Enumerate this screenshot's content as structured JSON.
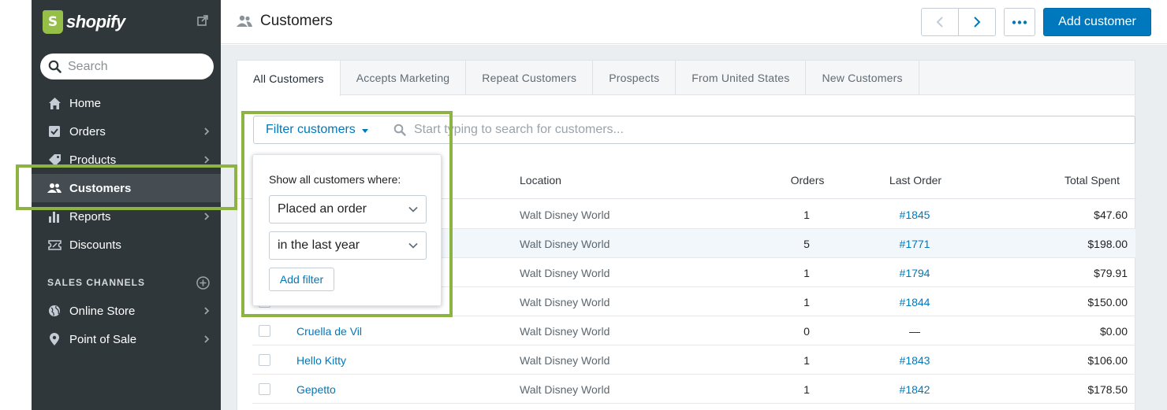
{
  "sidebar": {
    "logo": "shopify",
    "search_placeholder": "Search",
    "items": [
      {
        "label": "Home",
        "icon": "home-icon"
      },
      {
        "label": "Orders",
        "icon": "orders-icon"
      },
      {
        "label": "Products",
        "icon": "tag-icon"
      },
      {
        "label": "Customers",
        "icon": "customers-icon"
      },
      {
        "label": "Reports",
        "icon": "reports-icon"
      },
      {
        "label": "Discounts",
        "icon": "discount-icon"
      }
    ],
    "section_label": "SALES CHANNELS",
    "channels": [
      {
        "label": "Online Store",
        "icon": "globe-icon"
      },
      {
        "label": "Point of Sale",
        "icon": "location-pin-icon"
      }
    ]
  },
  "header": {
    "title": "Customers",
    "add_label": "Add customer"
  },
  "tabs": [
    {
      "label": "All Customers"
    },
    {
      "label": "Accepts Marketing"
    },
    {
      "label": "Repeat Customers"
    },
    {
      "label": "Prospects"
    },
    {
      "label": "From United States"
    },
    {
      "label": "New Customers"
    }
  ],
  "filter": {
    "button_label": "Filter customers",
    "search_placeholder": "Start typing to search for customers..."
  },
  "popover": {
    "label": "Show all customers where:",
    "condition": "Placed an order",
    "period": "in the last year",
    "add_filter": "Add filter"
  },
  "table": {
    "headers": {
      "location": "Location",
      "orders": "Orders",
      "last_order": "Last Order",
      "total": "Total Spent"
    },
    "rows": [
      {
        "name": "",
        "location": "Walt Disney World",
        "orders": "1",
        "last": "#1845",
        "total": "$47.60"
      },
      {
        "name": "",
        "location": "Walt Disney World",
        "orders": "5",
        "last": "#1771",
        "total": "$198.00"
      },
      {
        "name": "",
        "location": "Walt Disney World",
        "orders": "1",
        "last": "#1794",
        "total": "$79.91"
      },
      {
        "name": "",
        "location": "Walt Disney World",
        "orders": "1",
        "last": "#1844",
        "total": "$150.00"
      },
      {
        "name": "Cruella de Vil",
        "location": "Walt Disney World",
        "orders": "0",
        "last": "—",
        "total": "$0.00"
      },
      {
        "name": "Hello Kitty",
        "location": "Walt Disney World",
        "orders": "1",
        "last": "#1843",
        "total": "$106.00"
      },
      {
        "name": "Gepetto",
        "location": "Walt Disney World",
        "orders": "1",
        "last": "#1842",
        "total": "$178.50"
      }
    ]
  },
  "colors": {
    "sidebar_bg": "#30373b",
    "accent": "#0078bd",
    "highlight": "#8db443",
    "logo": "#95bf47"
  }
}
